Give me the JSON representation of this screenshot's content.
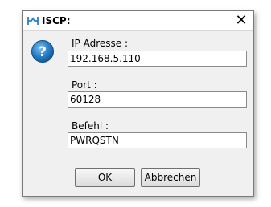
{
  "window": {
    "title": "ISCP:",
    "app_icon": "iscp-logo-icon",
    "close_glyph": "✕"
  },
  "form": {
    "help_icon": "question-icon",
    "ip": {
      "label": "IP Adresse :",
      "value": "192.168.5.110"
    },
    "port": {
      "label": "Port :",
      "value": "60128"
    },
    "command": {
      "label": "Befehl :",
      "value": "PWRQSTN"
    }
  },
  "buttons": {
    "ok_label": "OK",
    "cancel_label": "Abbrechen"
  },
  "colors": {
    "accent": "#2a7fc7",
    "dialog_bg": "#f0f0f0"
  }
}
